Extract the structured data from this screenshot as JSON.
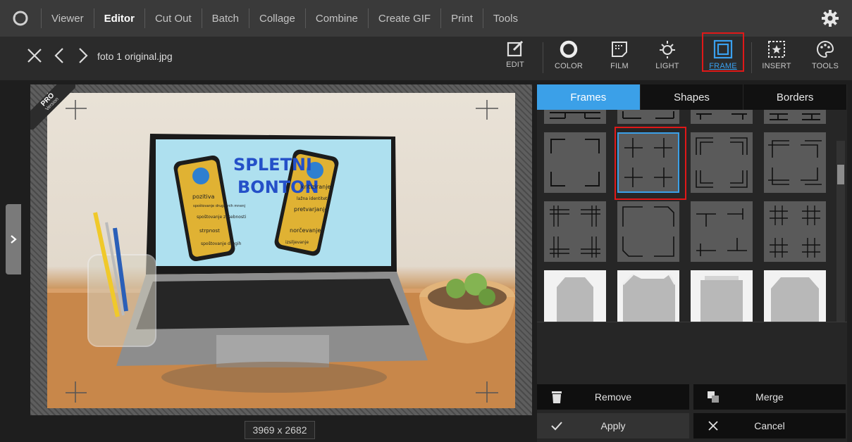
{
  "menu": {
    "items": [
      {
        "label": "Viewer",
        "active": false
      },
      {
        "label": "Editor",
        "active": true
      },
      {
        "label": "Cut Out",
        "active": false
      },
      {
        "label": "Batch",
        "active": false
      },
      {
        "label": "Collage",
        "active": false
      },
      {
        "label": "Combine",
        "active": false
      },
      {
        "label": "Create GIF",
        "active": false
      },
      {
        "label": "Print",
        "active": false
      },
      {
        "label": "Tools",
        "active": false
      }
    ],
    "settings_icon": "gear-icon"
  },
  "toolbar": {
    "filename": "foto 1 original.jpg",
    "tools": [
      {
        "label": "EDIT",
        "icon": "edit-icon"
      },
      {
        "label": "COLOR",
        "icon": "color-circle-icon"
      },
      {
        "label": "FILM",
        "icon": "film-icon"
      },
      {
        "label": "LIGHT",
        "icon": "sun-icon"
      },
      {
        "label": "FRAME",
        "icon": "frame-icon",
        "active": true
      },
      {
        "label": "INSERT",
        "icon": "insert-star-icon"
      },
      {
        "label": "TOOLS",
        "icon": "palette-icon"
      }
    ]
  },
  "canvas": {
    "badge_pro": "PRO",
    "badge_version": "Version",
    "dimensions": "3969 x 2682",
    "photo_screen_text": {
      "title_line1": "SPLETNI",
      "title_line2": "BONTON",
      "left_phone": [
        "pozitiva",
        "spoštovanje drugačnih mnenj",
        "spoštovanje zasebnosti",
        "strpnost",
        "spoštovanje drugih"
      ],
      "right_phone": [
        "kritiziranje",
        "lažna identiteta",
        "pretvarjanje",
        "norčevanje",
        "izsiljevanje"
      ]
    }
  },
  "panel": {
    "tabs": [
      {
        "label": "Frames",
        "active": true
      },
      {
        "label": "Shapes",
        "active": false
      },
      {
        "label": "Borders",
        "active": false
      }
    ],
    "actions": {
      "remove": "Remove",
      "merge": "Merge",
      "apply": "Apply",
      "cancel": "Cancel"
    }
  },
  "colors": {
    "accent": "#3ba0e8",
    "highlight": "#e01818",
    "menubar": "#3a3a3a",
    "toolbar": "#2b2b2b"
  }
}
